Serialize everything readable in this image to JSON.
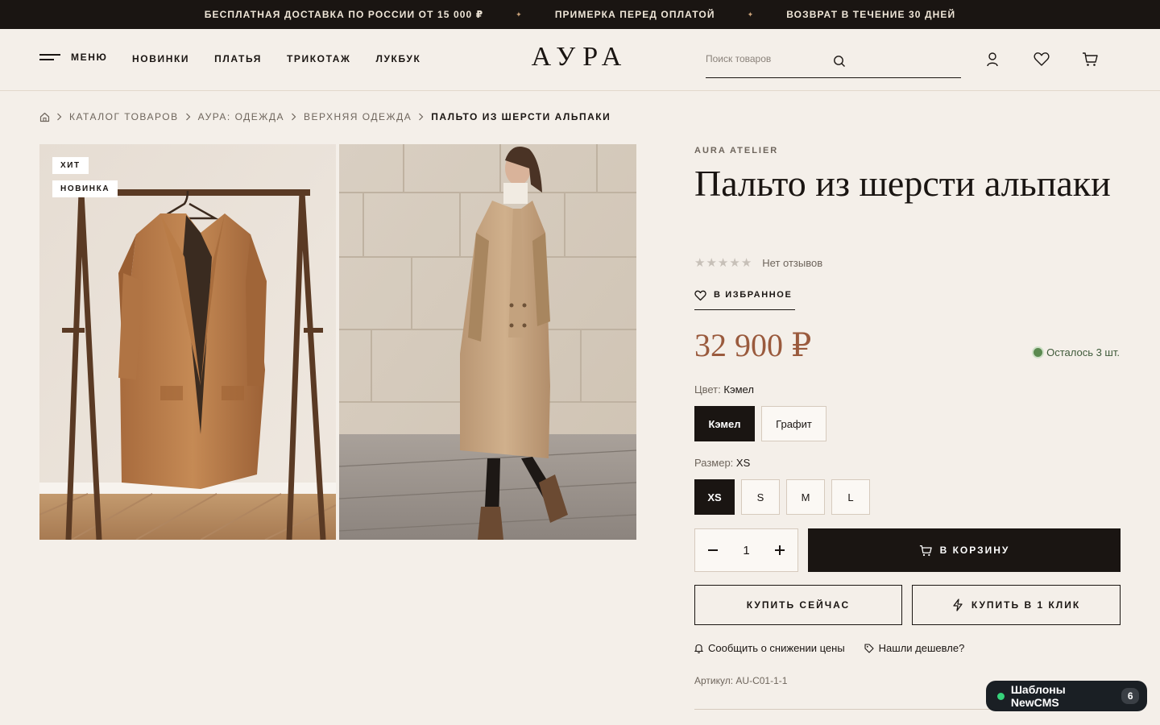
{
  "announcement": {
    "items": [
      "БЕСПЛАТНАЯ ДОСТАВКА ПО РОССИИ ОТ 15 000 ₽",
      "ПРИМЕРКА ПЕРЕД ОПЛАТОЙ",
      "ВОЗВРАТ В ТЕЧЕНИЕ 30 ДНЕЙ"
    ],
    "separator": "✦"
  },
  "header": {
    "menu_label": "МЕНЮ",
    "nav": [
      "НОВИНКИ",
      "ПЛАТЬЯ",
      "ТРИКОТАЖ",
      "ЛУКБУК"
    ],
    "logo": "АУРА",
    "search_placeholder": "Поиск товаров",
    "icons": [
      "user-icon",
      "heart-icon",
      "cart-icon"
    ]
  },
  "breadcrumb": {
    "items": [
      "КАТАЛОГ ТОВАРОВ",
      "АУРА: ОДЕЖДА",
      "ВЕРХНЯЯ ОДЕЖДА"
    ],
    "current": "ПАЛЬТО ИЗ ШЕРСТИ АЛЬПАКИ"
  },
  "gallery": {
    "badges": [
      "ХИТ",
      "НОВИНКА"
    ]
  },
  "product": {
    "brand": "AURA ATELIER",
    "title": "Пальто из шерсти альпаки",
    "rating_text": "Нет отзывов",
    "rating_value": 0,
    "favorite_label": "В ИЗБРАННОЕ",
    "price": "32 900 ₽",
    "stock": "Осталось 3 шт.",
    "color_label": "Цвет:",
    "color_selected": "Кэмел",
    "colors": [
      "Кэмел",
      "Графит"
    ],
    "size_label": "Размер:",
    "size_selected": "XS",
    "sizes": [
      "XS",
      "S",
      "M",
      "L"
    ],
    "quantity": "1",
    "cart_label": "В КОРЗИНУ",
    "buy_now_label": "КУПИТЬ СЕЙЧАС",
    "one_click_label": "КУПИТЬ В 1 КЛИК",
    "price_alert_label": "Сообщить о снижении цены",
    "cheaper_label": "Нашли дешевле?",
    "sku": "Артикул: AU-C01-1-1"
  },
  "widget": {
    "label": "Шаблоны NewCMS",
    "count": "6"
  },
  "colors": {
    "dark": "#1a1512",
    "background": "#f4efe9",
    "price": "#9a5a3d",
    "stock": "#5b8a50"
  }
}
